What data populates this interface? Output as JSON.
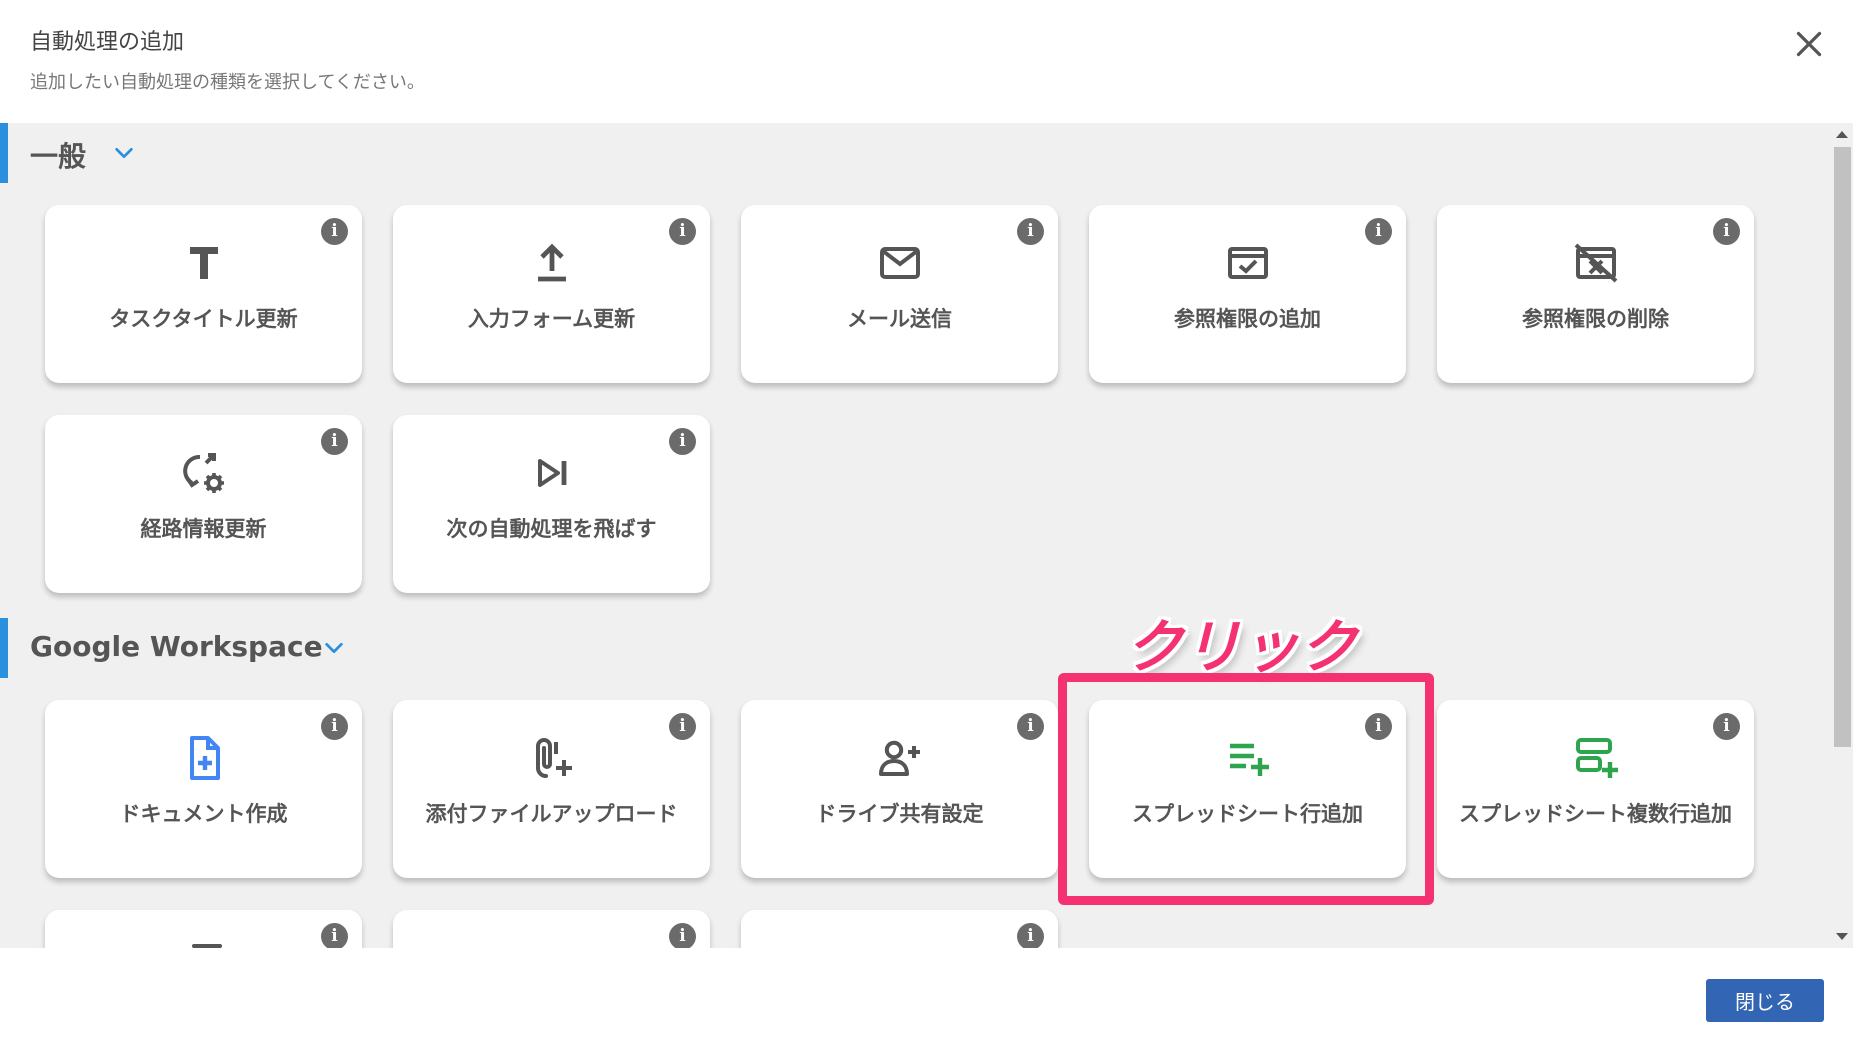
{
  "dialog": {
    "title": "自動処理の追加",
    "subtitle": "追加したい自動処理の種類を選択してください。",
    "close_icon": "close-icon"
  },
  "sections": {
    "general": {
      "title": "一般",
      "items": [
        {
          "label": "タスクタイトル更新",
          "icon": "title-text-icon",
          "color": "#555555"
        },
        {
          "label": "入力フォーム更新",
          "icon": "upload-arrow-icon",
          "color": "#555555"
        },
        {
          "label": "メール送信",
          "icon": "mail-icon",
          "color": "#555555"
        },
        {
          "label": "参照権限の追加",
          "icon": "permission-add-icon",
          "color": "#555555"
        },
        {
          "label": "参照権限の削除",
          "icon": "permission-remove-icon",
          "color": "#555555"
        },
        {
          "label": "経路情報更新",
          "icon": "route-settings-icon",
          "color": "#555555"
        },
        {
          "label": "次の自動処理を飛ばす",
          "icon": "skip-next-icon",
          "color": "#555555"
        }
      ]
    },
    "google": {
      "title": "Google Workspace",
      "items": [
        {
          "label": "ドキュメント作成",
          "icon": "document-add-icon",
          "color": "#4285f4"
        },
        {
          "label": "添付ファイルアップロード",
          "icon": "attachment-add-icon",
          "color": "#555555"
        },
        {
          "label": "ドライブ共有設定",
          "icon": "person-add-icon",
          "color": "#555555"
        },
        {
          "label": "スプレッドシート行追加",
          "icon": "row-add-icon",
          "color": "#2ea44f"
        },
        {
          "label": "スプレッドシート複数行追加",
          "icon": "rows-add-icon",
          "color": "#2ea44f"
        }
      ]
    }
  },
  "annotation": {
    "text": "クリック",
    "color": "#f43272"
  },
  "footer": {
    "close_label": "閉じる"
  },
  "colors": {
    "accent": "#2a8fdc",
    "button": "#3265b4"
  }
}
